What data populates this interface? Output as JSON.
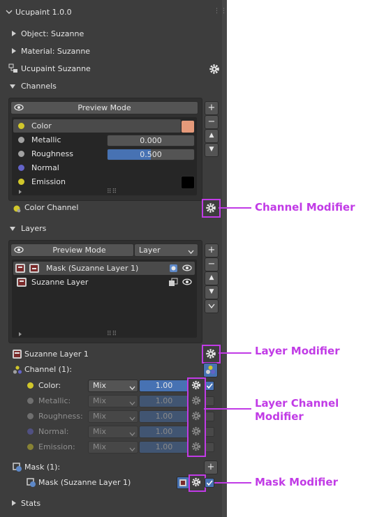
{
  "panel_title": "Ucupaint 1.0.0",
  "rows": {
    "object": "Object: Suzanne",
    "material": "Material: Suzanne",
    "ucupaint": "Ucupaint Suzanne",
    "channels": "Channels",
    "layers": "Layers",
    "stats": "Stats"
  },
  "channels": {
    "preview_mode": "Preview Mode",
    "items": [
      {
        "name": "Color",
        "color": "#d1c72b",
        "swatch": "#e69a7a"
      },
      {
        "name": "Metallic",
        "color": "#a1a1a1",
        "value": "0.000",
        "fill": 0.0
      },
      {
        "name": "Roughness",
        "color": "#a1a1a1",
        "value": "0.500",
        "fill": 0.5
      },
      {
        "name": "Normal",
        "color": "#6363c7",
        "value": ""
      },
      {
        "name": "Emission",
        "color": "#d1c72b",
        "swatch": "#000000"
      }
    ],
    "footer": "Color Channel"
  },
  "layers": {
    "preview_mode": "Preview Mode",
    "dropdown": "Layer",
    "items": [
      {
        "name": "Mask (Suzanne Layer 1)"
      },
      {
        "name": "Suzanne Layer"
      }
    ],
    "active_layer": "Suzanne Layer 1",
    "channel_header": "Channel (1):",
    "channel_rows": [
      {
        "name": "Color:",
        "blend": "Mix",
        "value": "1.00",
        "enabled": true,
        "dot": "#d1c72b"
      },
      {
        "name": "Metallic:",
        "blend": "Mix",
        "value": "1.00",
        "enabled": false,
        "dot": "#a1a1a1"
      },
      {
        "name": "Roughness:",
        "blend": "Mix",
        "value": "1.00",
        "enabled": false,
        "dot": "#a1a1a1"
      },
      {
        "name": "Normal:",
        "blend": "Mix",
        "value": "1.00",
        "enabled": false,
        "dot": "#6363c7"
      },
      {
        "name": "Emission:",
        "blend": "Mix",
        "value": "1.00",
        "enabled": false,
        "dot": "#d1c72b"
      }
    ],
    "mask_header": "Mask (1):",
    "mask_item": "Mask (Suzanne Layer 1)"
  },
  "annotations": {
    "channel_modifier": "Channel Modifier",
    "layer_modifier": "Layer Modifier",
    "layer_channel_modifier_1": "Layer Channel",
    "layer_channel_modifier_2": "Modifier",
    "mask_modifier": "Mask Modifier"
  },
  "colors": {
    "highlight": "#c13be6",
    "accent_blue": "#4772b3",
    "panel_bg": "#3d3d3d"
  }
}
